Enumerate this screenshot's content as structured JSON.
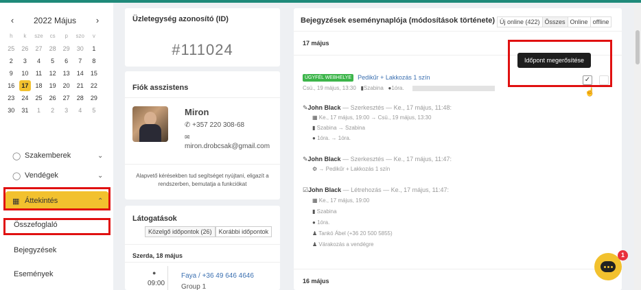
{
  "calendar": {
    "title": "2022 Május",
    "prev": "‹",
    "next": "›",
    "weekdays": [
      "h",
      "k",
      "sze",
      "cs",
      "p",
      "szo",
      "v"
    ],
    "weeks": [
      [
        "25",
        "26",
        "27",
        "28",
        "29",
        "30",
        "1"
      ],
      [
        "2",
        "3",
        "4",
        "5",
        "6",
        "7",
        "8"
      ],
      [
        "9",
        "10",
        "11",
        "12",
        "13",
        "14",
        "15"
      ],
      [
        "16",
        "17",
        "18",
        "19",
        "20",
        "21",
        "22"
      ],
      [
        "23",
        "24",
        "25",
        "26",
        "27",
        "28",
        "29"
      ],
      [
        "30",
        "31",
        "1",
        "2",
        "3",
        "4",
        "5"
      ]
    ],
    "today": "17"
  },
  "nav": {
    "specialists": "Szakemberek",
    "guests": "Vendégek",
    "overview": "Áttekintés",
    "summary": "Összefoglaló",
    "entries": "Bejegyzések",
    "events": "Események"
  },
  "business": {
    "title": "Üzletegység azonosító (ID)",
    "id": "#111024"
  },
  "assistant": {
    "title": "Fiók asszistens",
    "name": "Miron",
    "phone": "+357 220 308-68",
    "email": "miron.drobcsak@gmail.com",
    "description": "Alapvető kérésekben tud segítséget nyújtani, eligazít a rendszerben, bemutatja a funkciókat"
  },
  "visits": {
    "title": "Látogatások",
    "tab_upcoming": "Közelgő időpontok (26)",
    "tab_past": "Korábbi időpontok",
    "day": "Szerda, 18 május",
    "time": "09:00",
    "client": "Faya / +36 49 646 4646",
    "group": "Group 1"
  },
  "log": {
    "title": "Bejegyzések eseménynaplója (módosítások története)",
    "tabs": [
      "Új online (422)",
      "Összes",
      "Online",
      "offline"
    ],
    "date1": "17 május",
    "badge": "ÜGYFÉL WEBHELYE",
    "service": "Pedikűr + Lakkozás 1 szín",
    "meta_time": "Csü., 19 május, 13:30",
    "meta_staff": "Szabina",
    "meta_duration": "1óra.",
    "tooltip": "Időpont megerősítése",
    "e1_author": "John Black",
    "e1_action": " — Szerkesztés — Ke., 17 május, 11:48:",
    "e1_l1": "Ke., 17 május, 19:00 → Csü., 19 május, 13:30",
    "e1_l2": "Szabina → Szabina",
    "e1_l3": "1óra. → 1óra.",
    "e2_author": "John Black",
    "e2_action": " — Szerkesztés — Ke., 17 május, 11:47:",
    "e2_l1": "→ Pedikűr + Lakkozás 1 szín",
    "e3_author": "John Black",
    "e3_action": " — Létrehozás — Ke., 17 május, 11:47:",
    "e3_l1": "Ke., 17 május, 19:00",
    "e3_l2": "Szabina",
    "e3_l3": "1óra.",
    "e3_l4": "Tankó Ábel (+36 20 500 5855)",
    "e3_l5": "Várakozás a vendégre",
    "date2": "16 május"
  },
  "chat": {
    "notifications": "1"
  }
}
